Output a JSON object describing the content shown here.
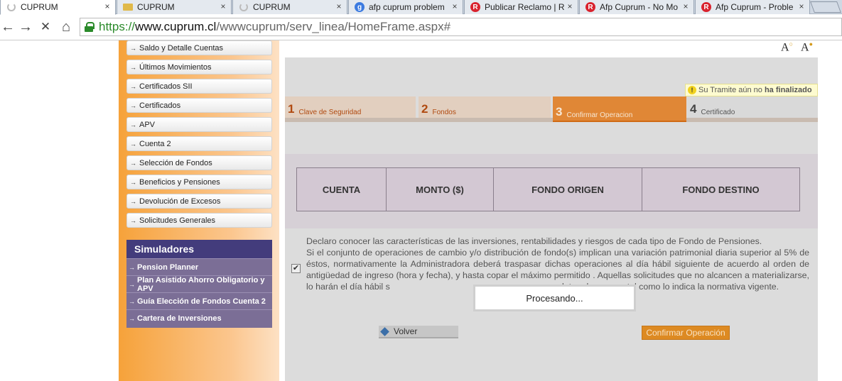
{
  "browser": {
    "tabs": [
      {
        "title": "CUPRUM",
        "icon": "loading-spinner-icon",
        "active": true
      },
      {
        "title": "CUPRUM",
        "icon": "folder-icon"
      },
      {
        "title": "CUPRUM",
        "icon": "loading-spinner-icon"
      },
      {
        "title": "afp cuprum problem",
        "icon": "google-icon",
        "icon_text": "g"
      },
      {
        "title": "Publicar Reclamo | R",
        "icon": "reclamos-icon",
        "icon_text": "R"
      },
      {
        "title": "Afp Cuprum - No Mo",
        "icon": "reclamos-icon",
        "icon_text": "R"
      },
      {
        "title": "Afp Cuprum - Proble",
        "icon": "reclamos-icon",
        "icon_text": "R"
      }
    ],
    "close_glyph": "×",
    "nav": {
      "back": "←",
      "forward": "→",
      "stop": "✕",
      "home": "⌂"
    },
    "url": {
      "scheme": "https://",
      "host": "www.cuprum.cl",
      "path": "/wwwcuprum/serv_linea/HomeFrame.aspx#"
    }
  },
  "sidebar": {
    "arrow": "→",
    "items": [
      "Saldo y Detalle Cuentas",
      "Últimos Movimientos",
      "Certificados SII",
      "Certificados",
      "APV",
      "Cuenta 2",
      "Selección de Fondos",
      "Beneficios y Pensiones",
      "Devolución de Excesos",
      "Solicitudes Generales"
    ]
  },
  "simuladores": {
    "title": "Simuladores",
    "items": [
      "Pension Planner",
      "Plan Asistido Ahorro Obligatorio y APV",
      "Guía Elección de Fondos Cuenta 2",
      "Cartera de Inversiones"
    ]
  },
  "font_controls": {
    "decrease": "A",
    "increase": "A"
  },
  "tramite_note": {
    "prefix": "Su Tramite aún no ",
    "bold": "ha finalizado"
  },
  "steps": [
    {
      "num": "1",
      "label": "Clave de Seguridad",
      "state": "done"
    },
    {
      "num": "2",
      "label": "Fondos",
      "state": "done"
    },
    {
      "num": "3",
      "label": "Confirmar Operacion",
      "state": "active"
    },
    {
      "num": "4",
      "label": "Certificado",
      "state": "todo"
    }
  ],
  "table": {
    "headers": [
      "CUENTA",
      "MONTO ($)",
      "FONDO ORIGEN",
      "FONDO DESTINO"
    ]
  },
  "declaration": {
    "line1": "Declaro conocer las características de las inversiones, rentabilidades y riesgos de cada tipo de Fondo de Pensiones.",
    "line2": "Si el conjunto de operaciones de cambio y/o distribución de fondo(s) implican una variación patrimonial diaria superior al 5% de éstos, normativamente la Administradora deberá traspasar dichas operaciones al día hábil siguiente de acuerdo al orden de antigüedad de ingreso (hora y fecha), y hasta copar el máximo permitido . Aquellas solicitudes que no alcancen a materializarse, lo harán el día hábil s",
    "line3": "mpletar el proceso, tal como lo indica la normativa vigente.",
    "checked": true
  },
  "buttons": {
    "volver": "Volver",
    "confirmar": "Confirmar Operación"
  },
  "modal": {
    "text": "Procesando..."
  }
}
